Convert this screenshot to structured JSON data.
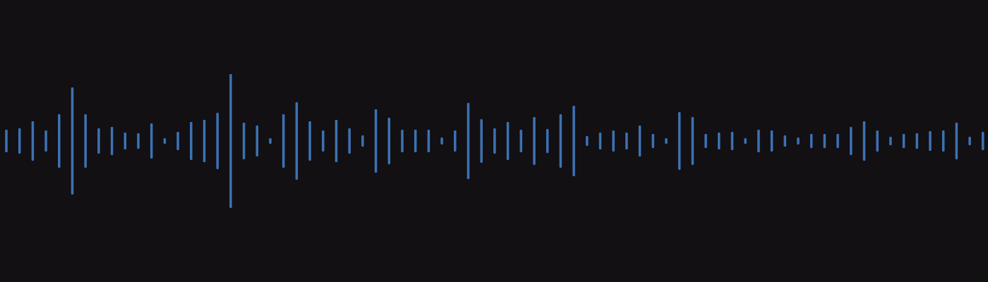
{
  "waveform": {
    "bar_color": "#3d72b4",
    "background_color": "#121013",
    "amplitudes": [
      0.16,
      0.18,
      0.28,
      0.15,
      0.38,
      0.76,
      0.38,
      0.18,
      0.2,
      0.12,
      0.11,
      0.25,
      0.04,
      0.13,
      0.27,
      0.3,
      0.4,
      0.95,
      0.26,
      0.22,
      0.04,
      0.38,
      0.55,
      0.28,
      0.15,
      0.3,
      0.18,
      0.08,
      0.45,
      0.33,
      0.16,
      0.16,
      0.16,
      0.05,
      0.15,
      0.54,
      0.31,
      0.18,
      0.27,
      0.16,
      0.34,
      0.17,
      0.38,
      0.5,
      0.07,
      0.12,
      0.15,
      0.12,
      0.22,
      0.1,
      0.04,
      0.41,
      0.34,
      0.1,
      0.12,
      0.13,
      0.04,
      0.16,
      0.15,
      0.08,
      0.05,
      0.1,
      0.1,
      0.1,
      0.2,
      0.28,
      0.15,
      0.06,
      0.1,
      0.11,
      0.14,
      0.15,
      0.26,
      0.06,
      0.13
    ]
  }
}
